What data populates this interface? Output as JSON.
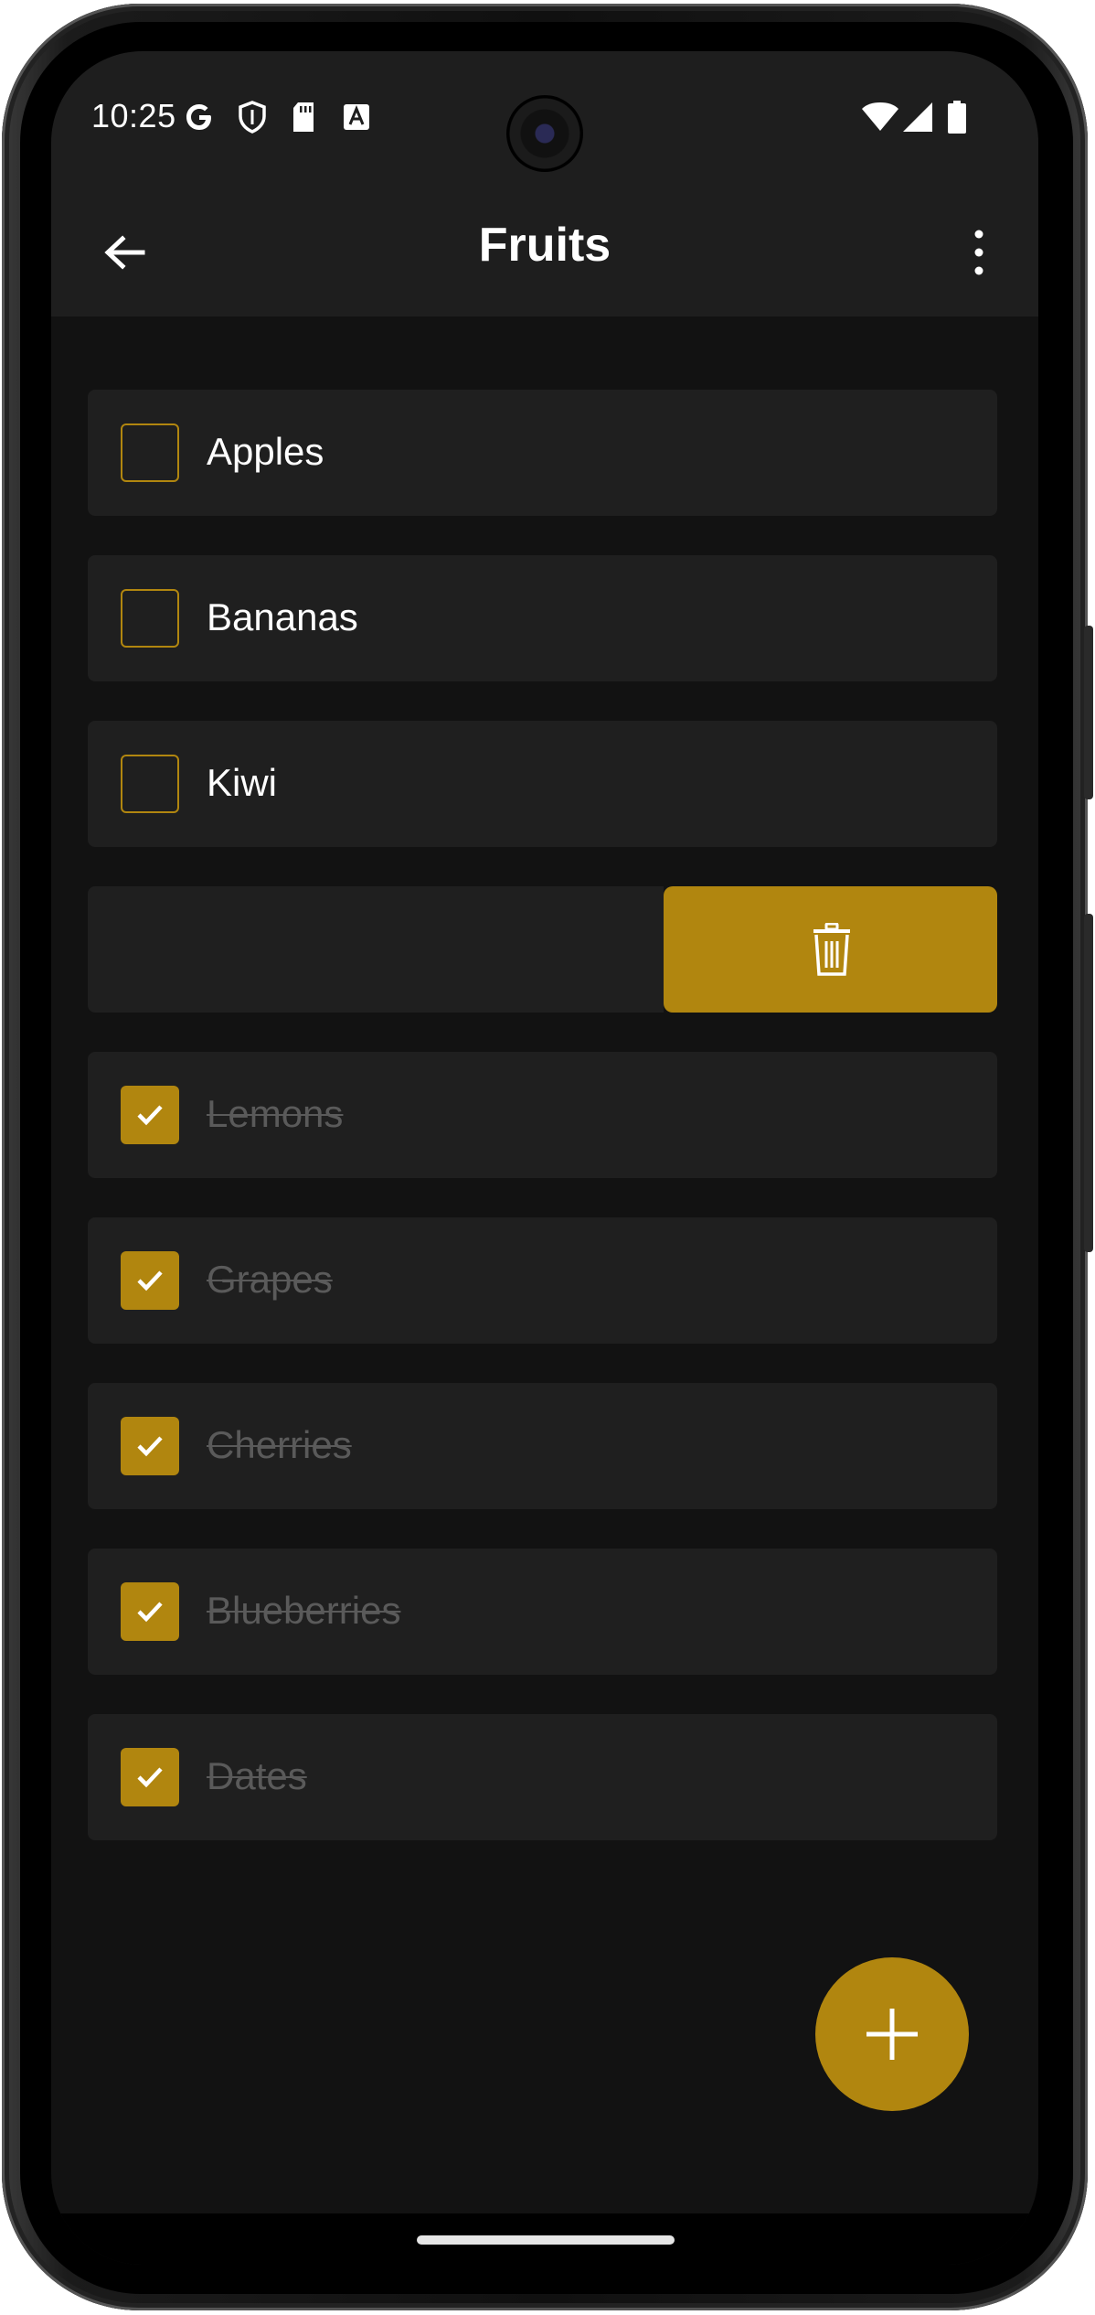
{
  "status_bar": {
    "time": "10:25",
    "icons": [
      "google-icon",
      "shield-icon",
      "sd-card-icon",
      "accessibility-text-icon",
      "wifi-icon",
      "signal-icon",
      "battery-icon"
    ]
  },
  "app_bar": {
    "title": "Fruits",
    "back_icon": "arrow-back-icon",
    "menu_icon": "more-vert-icon"
  },
  "items": [
    {
      "label": "Apples",
      "checked": false
    },
    {
      "label": "Bananas",
      "checked": false
    },
    {
      "label": "Kiwi",
      "checked": false
    },
    {
      "label": "",
      "checked": false,
      "swiped": true,
      "action_icon": "trash-icon"
    },
    {
      "label": "Lemons",
      "checked": true
    },
    {
      "label": "Grapes",
      "checked": true
    },
    {
      "label": "Cherries",
      "checked": true
    },
    {
      "label": "Blueberries",
      "checked": true
    },
    {
      "label": "Dates",
      "checked": true
    }
  ],
  "fab": {
    "icon": "plus-icon"
  },
  "colors": {
    "accent": "#b1860f",
    "background": "#121212",
    "surface": "#1f1f1f",
    "appbar": "#1e1e1e",
    "done_text": "#5a5a5a"
  }
}
